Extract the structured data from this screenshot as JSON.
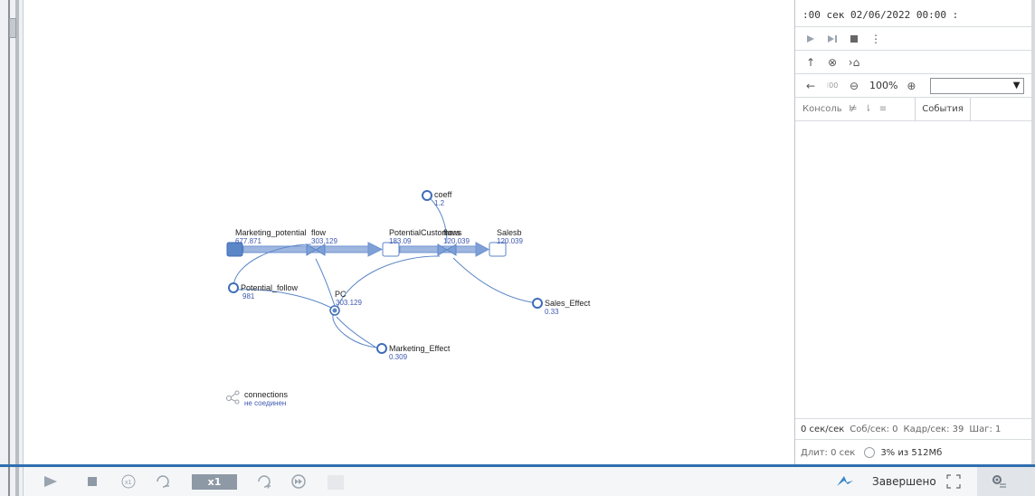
{
  "toolbar_top": {
    "time_text": ":00 сек  02/06/2022 00:00  :"
  },
  "zoom": {
    "level": "100%"
  },
  "console_tabs": {
    "console_label": "Консоль",
    "events_label": "События"
  },
  "stats": {
    "rate": "0 сек/сек",
    "events": "Соб/сек: 0",
    "frames": "Кадр/сек: 39",
    "step": "Шаг: 1",
    "duration": "Длит: 0 сек",
    "memory": "3% из 512Мб"
  },
  "bottom": {
    "speed": "x1",
    "status": "Завершено"
  },
  "model": {
    "stocks": [
      {
        "name": "Marketing_potential",
        "value": "677.871"
      },
      {
        "name": "PotentialCustomers",
        "value": "183.09"
      },
      {
        "name": "Salesb",
        "value": "120.039"
      }
    ],
    "flows": [
      {
        "name": "flow",
        "value": "303.129"
      },
      {
        "name": "flows",
        "value": "120.039"
      }
    ],
    "params": [
      {
        "name": "coeff",
        "value": "1.2"
      },
      {
        "name": "Potential_follow",
        "value": "981"
      },
      {
        "name": "Sales_Effect",
        "value": "0.33"
      },
      {
        "name": "Marketing_Effect",
        "value": "0.309"
      }
    ],
    "aux": {
      "name": "PC",
      "value": "303.129"
    },
    "connections": {
      "name": "connections",
      "status": "не соединен"
    }
  },
  "colors": {
    "accent": "#2f6fb0",
    "node": "#5b86c8",
    "value_text": "#3e58b0"
  }
}
